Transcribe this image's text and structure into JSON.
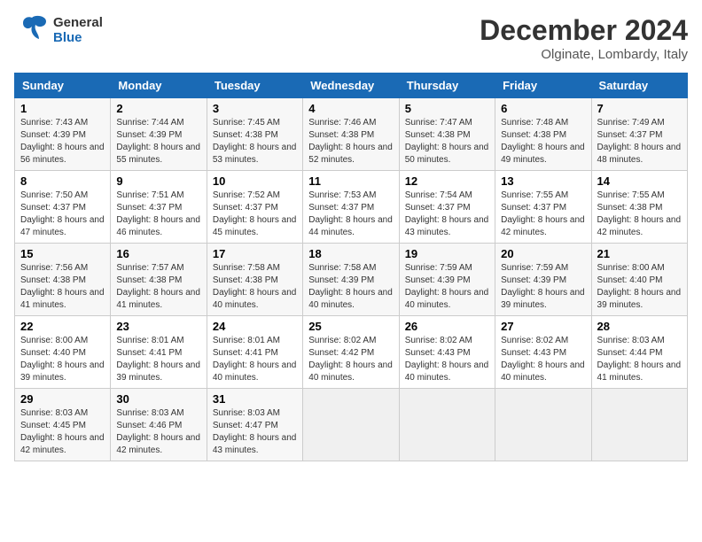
{
  "header": {
    "logo_line1": "General",
    "logo_line2": "Blue",
    "month_title": "December 2024",
    "location": "Olginate, Lombardy, Italy"
  },
  "days_of_week": [
    "Sunday",
    "Monday",
    "Tuesday",
    "Wednesday",
    "Thursday",
    "Friday",
    "Saturday"
  ],
  "weeks": [
    [
      {
        "day": "1",
        "sunrise": "Sunrise: 7:43 AM",
        "sunset": "Sunset: 4:39 PM",
        "daylight": "Daylight: 8 hours and 56 minutes."
      },
      {
        "day": "2",
        "sunrise": "Sunrise: 7:44 AM",
        "sunset": "Sunset: 4:39 PM",
        "daylight": "Daylight: 8 hours and 55 minutes."
      },
      {
        "day": "3",
        "sunrise": "Sunrise: 7:45 AM",
        "sunset": "Sunset: 4:38 PM",
        "daylight": "Daylight: 8 hours and 53 minutes."
      },
      {
        "day": "4",
        "sunrise": "Sunrise: 7:46 AM",
        "sunset": "Sunset: 4:38 PM",
        "daylight": "Daylight: 8 hours and 52 minutes."
      },
      {
        "day": "5",
        "sunrise": "Sunrise: 7:47 AM",
        "sunset": "Sunset: 4:38 PM",
        "daylight": "Daylight: 8 hours and 50 minutes."
      },
      {
        "day": "6",
        "sunrise": "Sunrise: 7:48 AM",
        "sunset": "Sunset: 4:38 PM",
        "daylight": "Daylight: 8 hours and 49 minutes."
      },
      {
        "day": "7",
        "sunrise": "Sunrise: 7:49 AM",
        "sunset": "Sunset: 4:37 PM",
        "daylight": "Daylight: 8 hours and 48 minutes."
      }
    ],
    [
      {
        "day": "8",
        "sunrise": "Sunrise: 7:50 AM",
        "sunset": "Sunset: 4:37 PM",
        "daylight": "Daylight: 8 hours and 47 minutes."
      },
      {
        "day": "9",
        "sunrise": "Sunrise: 7:51 AM",
        "sunset": "Sunset: 4:37 PM",
        "daylight": "Daylight: 8 hours and 46 minutes."
      },
      {
        "day": "10",
        "sunrise": "Sunrise: 7:52 AM",
        "sunset": "Sunset: 4:37 PM",
        "daylight": "Daylight: 8 hours and 45 minutes."
      },
      {
        "day": "11",
        "sunrise": "Sunrise: 7:53 AM",
        "sunset": "Sunset: 4:37 PM",
        "daylight": "Daylight: 8 hours and 44 minutes."
      },
      {
        "day": "12",
        "sunrise": "Sunrise: 7:54 AM",
        "sunset": "Sunset: 4:37 PM",
        "daylight": "Daylight: 8 hours and 43 minutes."
      },
      {
        "day": "13",
        "sunrise": "Sunrise: 7:55 AM",
        "sunset": "Sunset: 4:37 PM",
        "daylight": "Daylight: 8 hours and 42 minutes."
      },
      {
        "day": "14",
        "sunrise": "Sunrise: 7:55 AM",
        "sunset": "Sunset: 4:38 PM",
        "daylight": "Daylight: 8 hours and 42 minutes."
      }
    ],
    [
      {
        "day": "15",
        "sunrise": "Sunrise: 7:56 AM",
        "sunset": "Sunset: 4:38 PM",
        "daylight": "Daylight: 8 hours and 41 minutes."
      },
      {
        "day": "16",
        "sunrise": "Sunrise: 7:57 AM",
        "sunset": "Sunset: 4:38 PM",
        "daylight": "Daylight: 8 hours and 41 minutes."
      },
      {
        "day": "17",
        "sunrise": "Sunrise: 7:58 AM",
        "sunset": "Sunset: 4:38 PM",
        "daylight": "Daylight: 8 hours and 40 minutes."
      },
      {
        "day": "18",
        "sunrise": "Sunrise: 7:58 AM",
        "sunset": "Sunset: 4:39 PM",
        "daylight": "Daylight: 8 hours and 40 minutes."
      },
      {
        "day": "19",
        "sunrise": "Sunrise: 7:59 AM",
        "sunset": "Sunset: 4:39 PM",
        "daylight": "Daylight: 8 hours and 40 minutes."
      },
      {
        "day": "20",
        "sunrise": "Sunrise: 7:59 AM",
        "sunset": "Sunset: 4:39 PM",
        "daylight": "Daylight: 8 hours and 39 minutes."
      },
      {
        "day": "21",
        "sunrise": "Sunrise: 8:00 AM",
        "sunset": "Sunset: 4:40 PM",
        "daylight": "Daylight: 8 hours and 39 minutes."
      }
    ],
    [
      {
        "day": "22",
        "sunrise": "Sunrise: 8:00 AM",
        "sunset": "Sunset: 4:40 PM",
        "daylight": "Daylight: 8 hours and 39 minutes."
      },
      {
        "day": "23",
        "sunrise": "Sunrise: 8:01 AM",
        "sunset": "Sunset: 4:41 PM",
        "daylight": "Daylight: 8 hours and 39 minutes."
      },
      {
        "day": "24",
        "sunrise": "Sunrise: 8:01 AM",
        "sunset": "Sunset: 4:41 PM",
        "daylight": "Daylight: 8 hours and 40 minutes."
      },
      {
        "day": "25",
        "sunrise": "Sunrise: 8:02 AM",
        "sunset": "Sunset: 4:42 PM",
        "daylight": "Daylight: 8 hours and 40 minutes."
      },
      {
        "day": "26",
        "sunrise": "Sunrise: 8:02 AM",
        "sunset": "Sunset: 4:43 PM",
        "daylight": "Daylight: 8 hours and 40 minutes."
      },
      {
        "day": "27",
        "sunrise": "Sunrise: 8:02 AM",
        "sunset": "Sunset: 4:43 PM",
        "daylight": "Daylight: 8 hours and 40 minutes."
      },
      {
        "day": "28",
        "sunrise": "Sunrise: 8:03 AM",
        "sunset": "Sunset: 4:44 PM",
        "daylight": "Daylight: 8 hours and 41 minutes."
      }
    ],
    [
      {
        "day": "29",
        "sunrise": "Sunrise: 8:03 AM",
        "sunset": "Sunset: 4:45 PM",
        "daylight": "Daylight: 8 hours and 42 minutes."
      },
      {
        "day": "30",
        "sunrise": "Sunrise: 8:03 AM",
        "sunset": "Sunset: 4:46 PM",
        "daylight": "Daylight: 8 hours and 42 minutes."
      },
      {
        "day": "31",
        "sunrise": "Sunrise: 8:03 AM",
        "sunset": "Sunset: 4:47 PM",
        "daylight": "Daylight: 8 hours and 43 minutes."
      },
      null,
      null,
      null,
      null
    ]
  ]
}
